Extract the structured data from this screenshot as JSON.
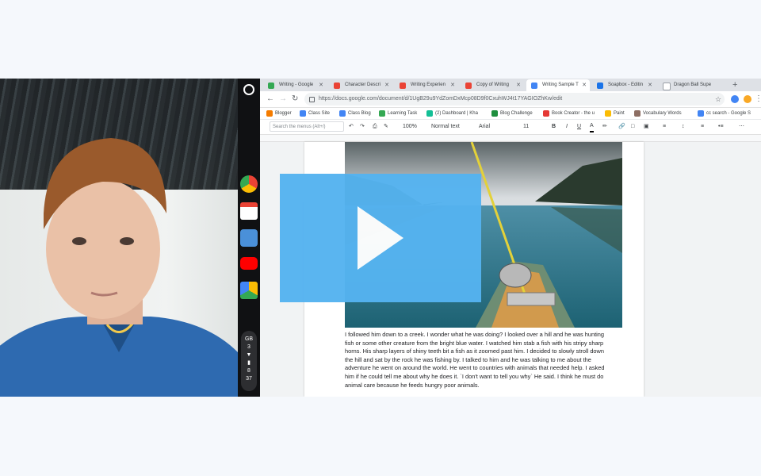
{
  "browser": {
    "tabs": [
      {
        "label": "Writing - Google",
        "color": "#34a853"
      },
      {
        "label": "Character Descri",
        "color": "#ea4335"
      },
      {
        "label": "Writing Experien",
        "color": "#ea4335"
      },
      {
        "label": "Copy of Writing",
        "color": "#ea4335"
      },
      {
        "label": "Writing Sample T",
        "color": "#4285f4",
        "active": true
      },
      {
        "label": "Soapbox - Editin",
        "color": "#1a73e8"
      },
      {
        "label": "Dragon Ball Supe",
        "color": "#9aa0a6"
      }
    ],
    "new_tab": "+",
    "url": "https://docs.google.com/document/d/1UgB29u9YdZomDxMcp08D9f0CxuhWJ4t17YAGIOZhKw/edit",
    "bookmarks": [
      {
        "label": "Blogger",
        "color": "#f57c00"
      },
      {
        "label": "Class Site",
        "color": "#4285f4"
      },
      {
        "label": "Class Blog",
        "color": "#4285f4"
      },
      {
        "label": "Learning Task",
        "color": "#34a853"
      },
      {
        "label": "(2) Dashboard | Kha",
        "color": "#14bf96"
      },
      {
        "label": "Blog Challenge",
        "color": "#1e8e3e"
      },
      {
        "label": "Book Creator - the u",
        "color": "#e53935"
      },
      {
        "label": "Paint",
        "color": "#fbbc04"
      },
      {
        "label": "Vocabulary Words",
        "color": "#8d6e63"
      },
      {
        "label": "cc search - Google S",
        "color": "#4285f4"
      }
    ]
  },
  "docs_toolbar": {
    "search_placeholder": "Search the menus (Alt+/)",
    "zoom": "100%",
    "style": "Normal text",
    "font": "Arial",
    "font_size": "11",
    "bold": "B",
    "italic": "I",
    "underline": "U",
    "text_color": "A"
  },
  "document": {
    "body": "I followed him down to a creek. I wonder what he was doing? I looked over a hill and he was hunting fish or some other creature from the bright blue water. I watched him stab a fish with his stripy sharp horns. His sharp layers of shiny teeth bit a fish as it zoomed past him. I decided to slowly stroll down the hill and sat by the rock he was fishing by. I talked to him and he was talking to me about the adventure he went on around the world. He went to countries with animals that needed help. I asked him if he could tell me about why he does it. `I don't want to tell you why` He said. I think he must do animal care because he feeds hungry poor animals."
  },
  "shelf": {
    "apps": [
      "chrome-icon",
      "gmail-icon",
      "files-icon",
      "youtube-icon",
      "drive-icon"
    ],
    "status": {
      "lang": "GB",
      "badge": "3",
      "hour": "8",
      "minute": "37"
    }
  },
  "video": {
    "play_color": "#55b3f0"
  }
}
